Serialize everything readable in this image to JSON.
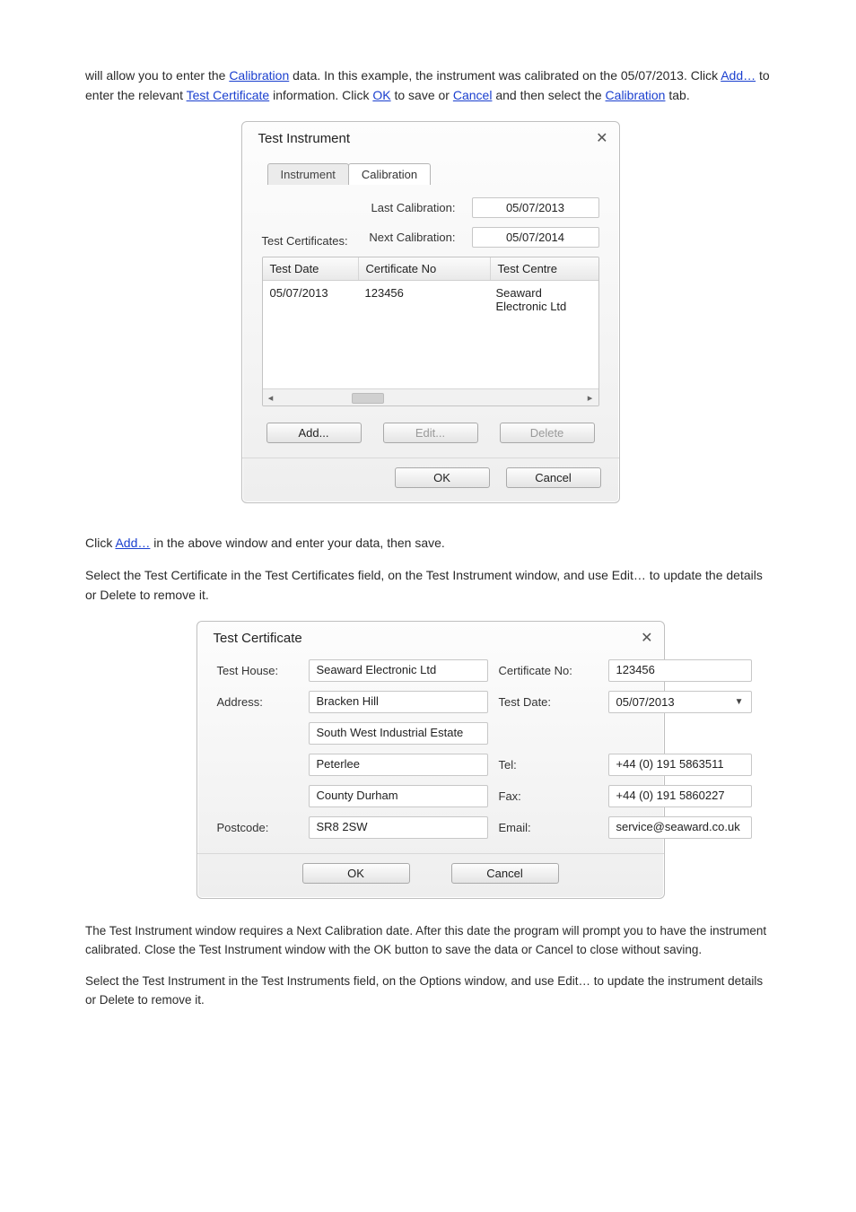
{
  "intro": {
    "part1": "will allow you to enter the ",
    "link1": "Calibration",
    "part2": " data. In this example, the instrument was calibrated on the 05/07/2013. Click ",
    "link2": "Add…",
    "part3": " to enter the relevant ",
    "link3": "Test Certificate",
    "part4": " information. Click ",
    "link4": "OK",
    "part5": " to save or ",
    "link5": "Cancel",
    "part6": " and then select the ",
    "link6": "Calibration",
    "part7": " tab."
  },
  "dlg1": {
    "title": "Test Instrument",
    "tabs": {
      "instrument": "Instrument",
      "calibration": "Calibration"
    },
    "lastLabel": "Last Calibration:",
    "lastValue": "05/07/2013",
    "nextLabel": "Next Calibration:",
    "nextValue": "05/07/2014",
    "certLabel": "Test Certificates:",
    "head": {
      "date": "Test Date",
      "cert": "Certificate No",
      "centre": "Test Centre"
    },
    "row": {
      "date": "05/07/2013",
      "cert": "123456",
      "centre": "Seaward Electronic Ltd"
    },
    "add": "Add...",
    "edit": "Edit...",
    "delete": "Delete",
    "ok": "OK",
    "cancel": "Cancel"
  },
  "mid": {
    "p1a": "Click ",
    "p1link": "Add…",
    "p1b": " in the above window and enter your data, then save.",
    "p2": "Select the Test Certificate in the Test Certificates field, on the Test Instrument window, and use Edit… to update the details or Delete to remove it."
  },
  "dlg2": {
    "title": "Test Certificate",
    "labels": {
      "house": "Test House:",
      "addr": "Address:",
      "post": "Postcode:",
      "certno": "Certificate No:",
      "tdate": "Test Date:",
      "tel": "Tel:",
      "fax": "Fax:",
      "email": "Email:"
    },
    "vals": {
      "house": "Seaward Electronic Ltd",
      "addr1": "Bracken Hill",
      "addr2": "South West Industrial Estate",
      "addr3": "Peterlee",
      "addr4": "County Durham",
      "post": "SR8 2SW",
      "certno": "123456",
      "tdate": "05/07/2013",
      "tel": "+44 (0) 191 5863511",
      "fax": "+44 (0) 191 5860227",
      "email": "service@seaward.co.uk"
    },
    "ok": "OK",
    "cancel": "Cancel"
  },
  "bottom": {
    "p1": "The Test Instrument window requires a Next Calibration date. After this date the program will prompt you to have the instrument calibrated. Close the Test Instrument window with the OK button to save the data or Cancel to close without saving.",
    "p2": "Select the Test Instrument in the Test Instruments field, on the Options window, and use Edit… to update the instrument details or Delete to remove it."
  }
}
